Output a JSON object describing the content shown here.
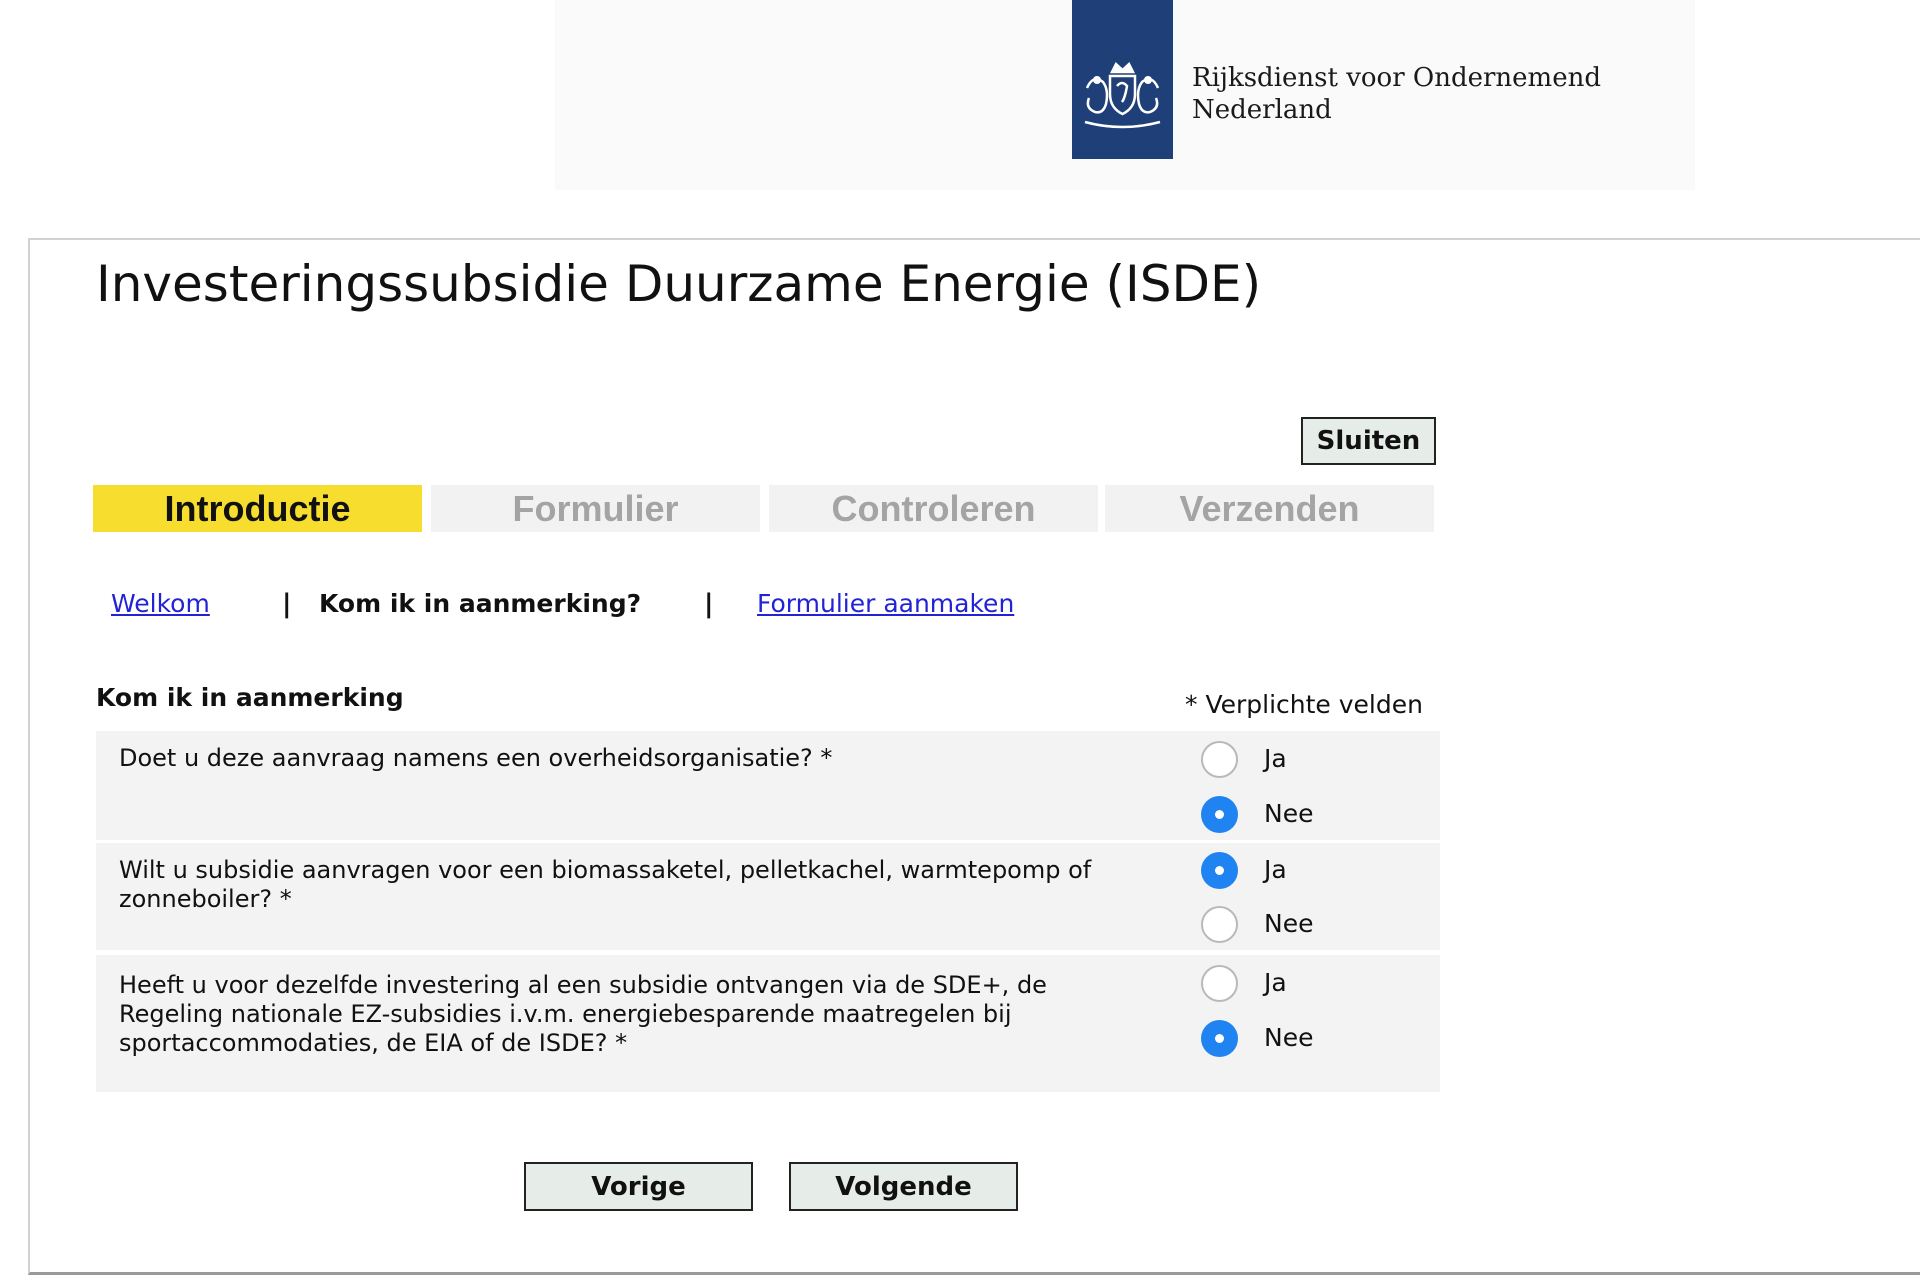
{
  "header": {
    "org_name_line1": "Rijksdienst voor Ondernemend",
    "org_name_line2": "Nederland",
    "logo_color": "#1f3f78"
  },
  "page_title": "Investeringssubsidie Duurzame Energie (ISDE)",
  "close_button": "Sluiten",
  "steps": [
    {
      "label": "Introductie",
      "active": true
    },
    {
      "label": "Formulier",
      "active": false
    },
    {
      "label": "Controleren",
      "active": false
    },
    {
      "label": "Verzenden",
      "active": false
    }
  ],
  "subnav": {
    "items": [
      "Welkom",
      "Kom ik in aanmerking?",
      "Formulier aanmaken"
    ],
    "separator": "|"
  },
  "form": {
    "section_title": "Kom ik in aanmerking",
    "required_note": "* Verplichte velden",
    "option_yes": "Ja",
    "option_no": "Nee",
    "questions": [
      {
        "text": "Doet u deze aanvraag namens een overheidsorganisatie? *",
        "selected": "Nee"
      },
      {
        "text": "Wilt u subsidie aanvragen voor een biomassaketel, pelletkachel, warmtepomp of zonneboiler? *",
        "selected": "Ja"
      },
      {
        "text": "Heeft u voor dezelfde investering al een subsidie ontvangen via de SDE+, de Regeling nationale EZ-subsidies i.v.m. energiebesparende maatregelen bij sportaccommodaties, de EIA of de ISDE? *",
        "selected": "Nee"
      }
    ]
  },
  "buttons": {
    "previous": "Vorige",
    "next": "Volgende"
  },
  "colors": {
    "active_step": "#f7dd2e",
    "radio_checked": "#1f83f2",
    "link": "#2323d6"
  }
}
